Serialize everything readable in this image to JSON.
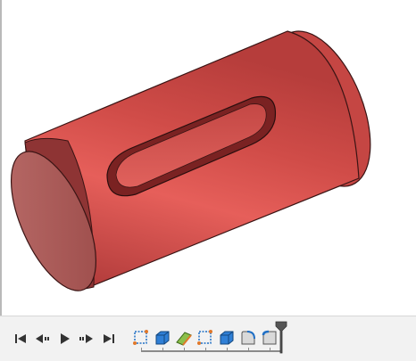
{
  "viewport": {
    "model": "cylinder-with-slot",
    "body_color": "#d45350",
    "shadow_color": "#8e2a2a",
    "highlight_color": "#ee6b66"
  },
  "timeline": {
    "playback_controls": [
      {
        "name": "skip-to-start",
        "icon": "skip-start-icon"
      },
      {
        "name": "step-back",
        "icon": "step-back-icon"
      },
      {
        "name": "play",
        "icon": "play-icon"
      },
      {
        "name": "step-forward",
        "icon": "step-forward-icon"
      },
      {
        "name": "skip-to-end",
        "icon": "skip-end-icon"
      }
    ],
    "features": [
      {
        "name": "sketch-1",
        "icon": "sketch-icon"
      },
      {
        "name": "extrude-1",
        "icon": "extrude-icon"
      },
      {
        "name": "chamfer-1",
        "icon": "chamfer-icon"
      },
      {
        "name": "sketch-2",
        "icon": "sketch-icon"
      },
      {
        "name": "extrude-2",
        "icon": "extrude-icon"
      },
      {
        "name": "fillet-1",
        "icon": "fillet-icon"
      },
      {
        "name": "fillet-2",
        "icon": "fillet-icon"
      }
    ],
    "colors": {
      "accent": "#1f6fc5",
      "marker": "#555555"
    }
  }
}
